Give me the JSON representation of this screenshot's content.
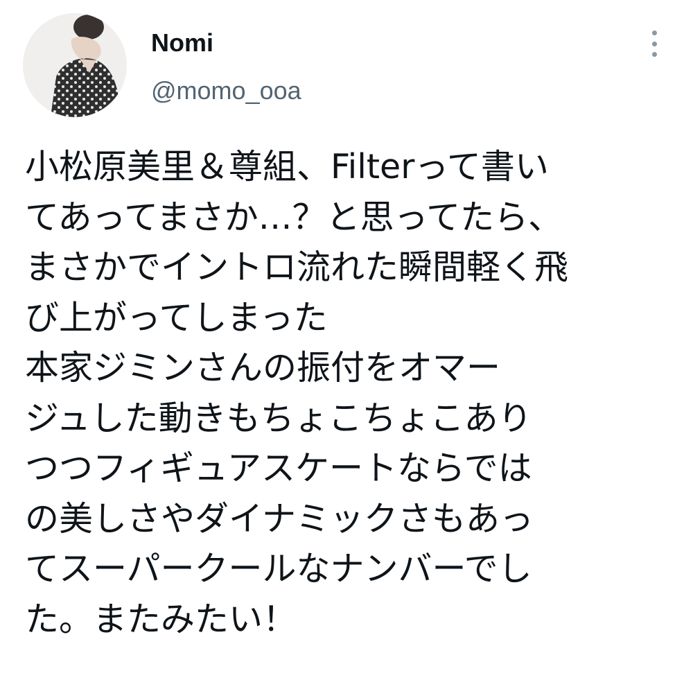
{
  "tweet": {
    "author": {
      "name": "Nomi",
      "handle": "@momo_ooa",
      "avatar_icon": "profile-photo"
    },
    "more_icon": "more-vertical-icon",
    "text_lines": [
      "小松原美里＆尊組、Filterって書い",
      "てあってまさか…？と思ってたら、",
      "まさかでイントロ流れた瞬間軽く飛",
      "び上がってしまった",
      "本家ジミンさんの振付をオマー",
      "ジュした動きもちょこちょこあり",
      "つつフィギュアスケートならでは",
      "の美しさやダイナミックさもあっ",
      "てスーパークールなナンバーでし",
      "た。またみたい！"
    ]
  },
  "colors": {
    "text": "#0f1419",
    "handle": "#536471",
    "icon": "#8b98a5",
    "background": "#ffffff"
  }
}
